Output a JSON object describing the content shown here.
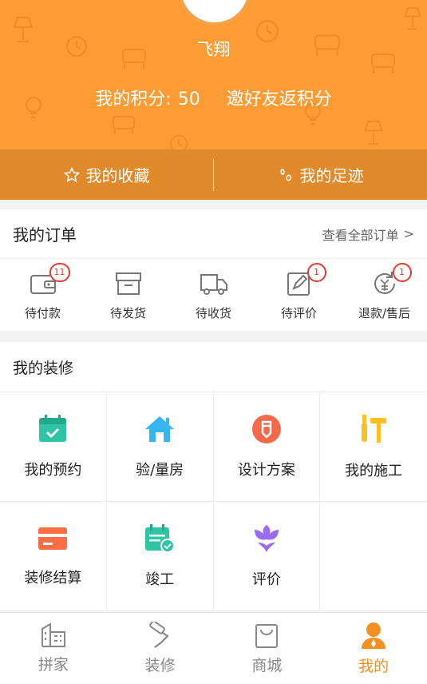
{
  "header": {
    "username": "飞翔",
    "points_label": "我的积分:",
    "points_value": "50",
    "invite_label": "邀好友返积分",
    "favorites_label": "我的收藏",
    "footprints_label": "我的足迹"
  },
  "orders": {
    "title": "我的订单",
    "view_all_label": "查看全部订单",
    "chevron": ">",
    "items": [
      {
        "label": "待付款",
        "icon": "wallet-icon",
        "badge": "11"
      },
      {
        "label": "待发货",
        "icon": "box-icon",
        "badge": ""
      },
      {
        "label": "待收货",
        "icon": "truck-icon",
        "badge": ""
      },
      {
        "label": "待评价",
        "icon": "pen-edit-icon",
        "badge": "1"
      },
      {
        "label": "退款/售后",
        "icon": "refund-icon",
        "badge": "1"
      }
    ]
  },
  "decoration": {
    "title": "我的装修",
    "items": [
      {
        "label": "我的预约",
        "icon": "calendar-check-icon",
        "color": "#2fc4a5"
      },
      {
        "label": "验/量房",
        "icon": "house-icon",
        "color": "#35b6ef"
      },
      {
        "label": "设计方案",
        "icon": "pencil-circle-icon",
        "color": "#f4694a"
      },
      {
        "label": "我的施工",
        "icon": "tools-icon",
        "color": "#fbbf24"
      },
      {
        "label": "装修结算",
        "icon": "card-icon",
        "color": "#fb6d45"
      },
      {
        "label": "竣工",
        "icon": "calendar-done-icon",
        "color": "#2fc4a5"
      },
      {
        "label": "评价",
        "icon": "flower-icon",
        "color": "#9b6bf2"
      }
    ]
  },
  "bottom_nav": [
    {
      "label": "拼家",
      "icon": "building-icon",
      "active": false
    },
    {
      "label": "装修",
      "icon": "paint-roller-icon",
      "active": false
    },
    {
      "label": "商城",
      "icon": "shopping-bag-icon",
      "active": false
    },
    {
      "label": "我的",
      "icon": "user-avatar-icon",
      "active": true
    }
  ],
  "colors": {
    "header_bg": "#fd9b35",
    "header_bar_bg": "#e18a2c",
    "accent": "#f39020",
    "badge": "#e23b2f"
  }
}
